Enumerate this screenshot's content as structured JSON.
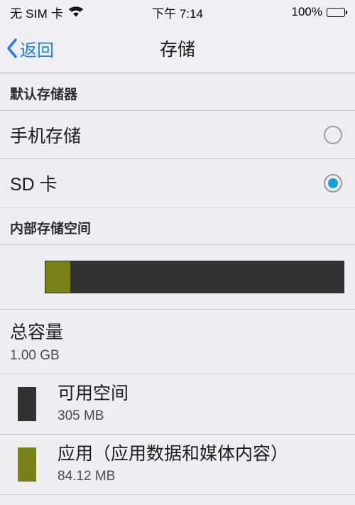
{
  "statusbar": {
    "carrier": "无 SIM 卡",
    "wifi_icon": "wifi-icon",
    "time": "下午 7:14",
    "battery_percent": "100%",
    "battery_icon": "battery-full-icon",
    "battery_level": 100
  },
  "navbar": {
    "back_label": "返回",
    "back_icon": "chevron-left-icon",
    "title": "存储"
  },
  "sections": {
    "default_storage": {
      "header": "默认存储器",
      "options": [
        {
          "label": "手机存储",
          "selected": false
        },
        {
          "label": "SD 卡",
          "selected": true
        }
      ]
    },
    "internal_storage": {
      "header": "内部存储空间",
      "bar": {
        "segments": [
          {
            "name": "apps",
            "percent": 8.3,
            "color": "#788018"
          },
          {
            "name": "free",
            "percent": 91.7,
            "color": "#333334"
          }
        ]
      },
      "total": {
        "title": "总容量",
        "value": "1.00 GB"
      },
      "legend": [
        {
          "title": "可用空间",
          "value": "305 MB",
          "color": "#333334"
        },
        {
          "title": "应用（应用数据和媒体内容）",
          "value": "84.12 MB",
          "color": "#788018"
        }
      ]
    }
  },
  "colors": {
    "accent_blue": "#1a7df0",
    "radio_blue": "#13a0dc",
    "apps_olive": "#788018",
    "free_dark": "#333334",
    "background": "#eeeef2"
  }
}
